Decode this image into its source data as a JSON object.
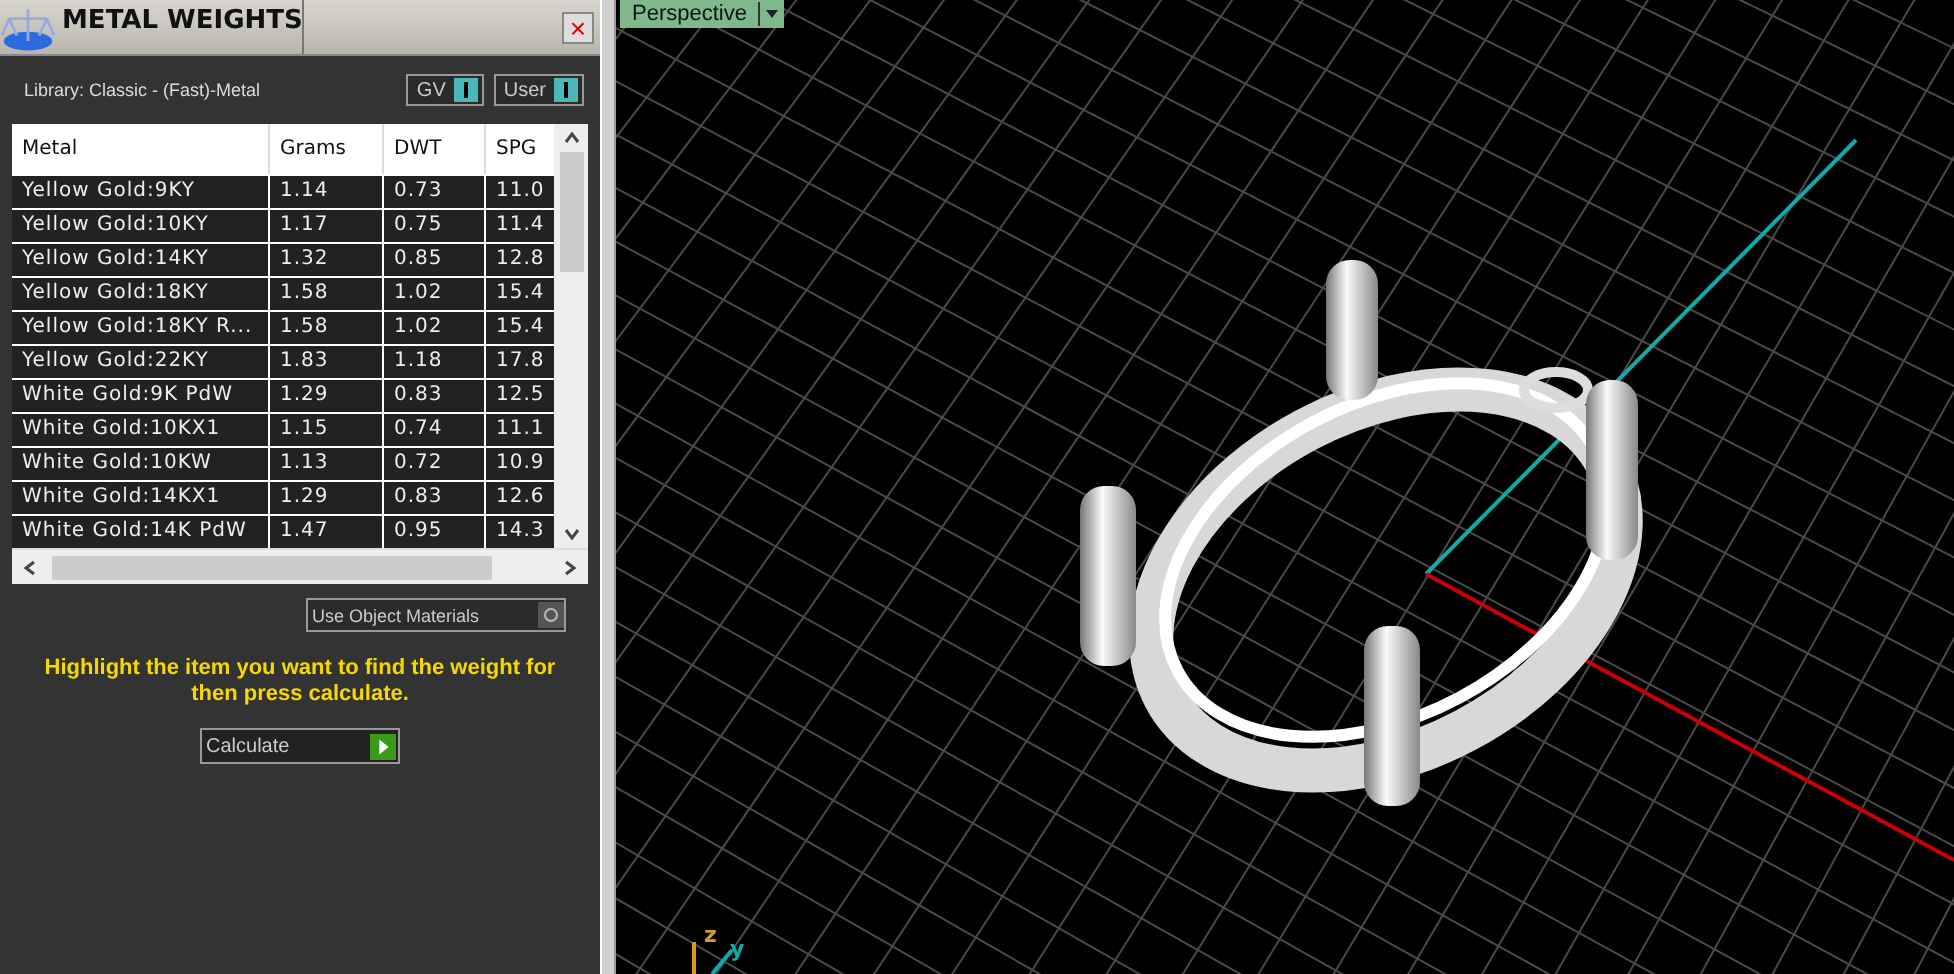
{
  "panel": {
    "title": "METAL WEIGHTS",
    "close": "×",
    "library": "Library: Classic - (Fast)-Metal",
    "toggles": [
      {
        "label": "GV",
        "on": true
      },
      {
        "label": "User",
        "on": true
      }
    ]
  },
  "table": {
    "columns": [
      "Metal",
      "Grams",
      "DWT",
      "SPG"
    ],
    "rows": [
      [
        "Yellow Gold:9KY",
        "1.14",
        "0.73",
        "11.0"
      ],
      [
        "Yellow Gold:10KY",
        "1.17",
        "0.75",
        "11.4"
      ],
      [
        "Yellow Gold:14KY",
        "1.32",
        "0.85",
        "12.8"
      ],
      [
        "Yellow Gold:18KY",
        "1.58",
        "1.02",
        "15.4"
      ],
      [
        "Yellow Gold:18KY R...",
        "1.58",
        "1.02",
        "15.4"
      ],
      [
        "Yellow Gold:22KY",
        "1.83",
        "1.18",
        "17.8"
      ],
      [
        "White Gold:9K PdW",
        "1.29",
        "0.83",
        "12.5"
      ],
      [
        "White Gold:10KX1",
        "1.15",
        "0.74",
        "11.1"
      ],
      [
        "White Gold:10KW",
        "1.13",
        "0.72",
        "10.9"
      ],
      [
        "White Gold:14KX1",
        "1.29",
        "0.83",
        "12.6"
      ],
      [
        "White Gold:14K PdW",
        "1.47",
        "0.95",
        "14.3"
      ]
    ]
  },
  "use_object_materials": {
    "label": "Use Object Materials",
    "checked": false
  },
  "hint": "Highlight the item you want to find the weight for then press calculate.",
  "calculate": "Calculate",
  "viewport": {
    "view": "Perspective",
    "axes": [
      "z",
      "y"
    ]
  }
}
